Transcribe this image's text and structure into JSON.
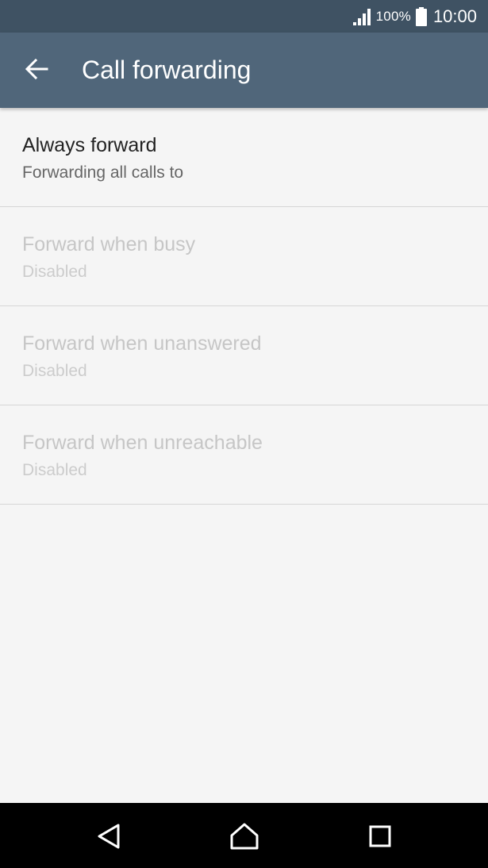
{
  "status_bar": {
    "battery_percent": "100%",
    "time": "10:00",
    "icons": [
      "signal-icon",
      "battery-icon"
    ]
  },
  "app_bar": {
    "title": "Call forwarding",
    "back_icon": "arrow-left-icon"
  },
  "items": [
    {
      "title": "Always forward",
      "subtitle": "Forwarding all calls to",
      "enabled": true
    },
    {
      "title": "Forward when busy",
      "subtitle": "Disabled",
      "enabled": false
    },
    {
      "title": "Forward when unanswered",
      "subtitle": "Disabled",
      "enabled": false
    },
    {
      "title": "Forward when unreachable",
      "subtitle": "Disabled",
      "enabled": false
    }
  ],
  "nav_bar": {
    "icons": [
      "back-triangle-icon",
      "home-icon",
      "recents-square-icon"
    ]
  },
  "colors": {
    "status_bar_bg": "#3f5263",
    "app_bar_bg": "#50667a",
    "page_bg": "#f5f5f5",
    "nav_bar_bg": "#000000"
  }
}
